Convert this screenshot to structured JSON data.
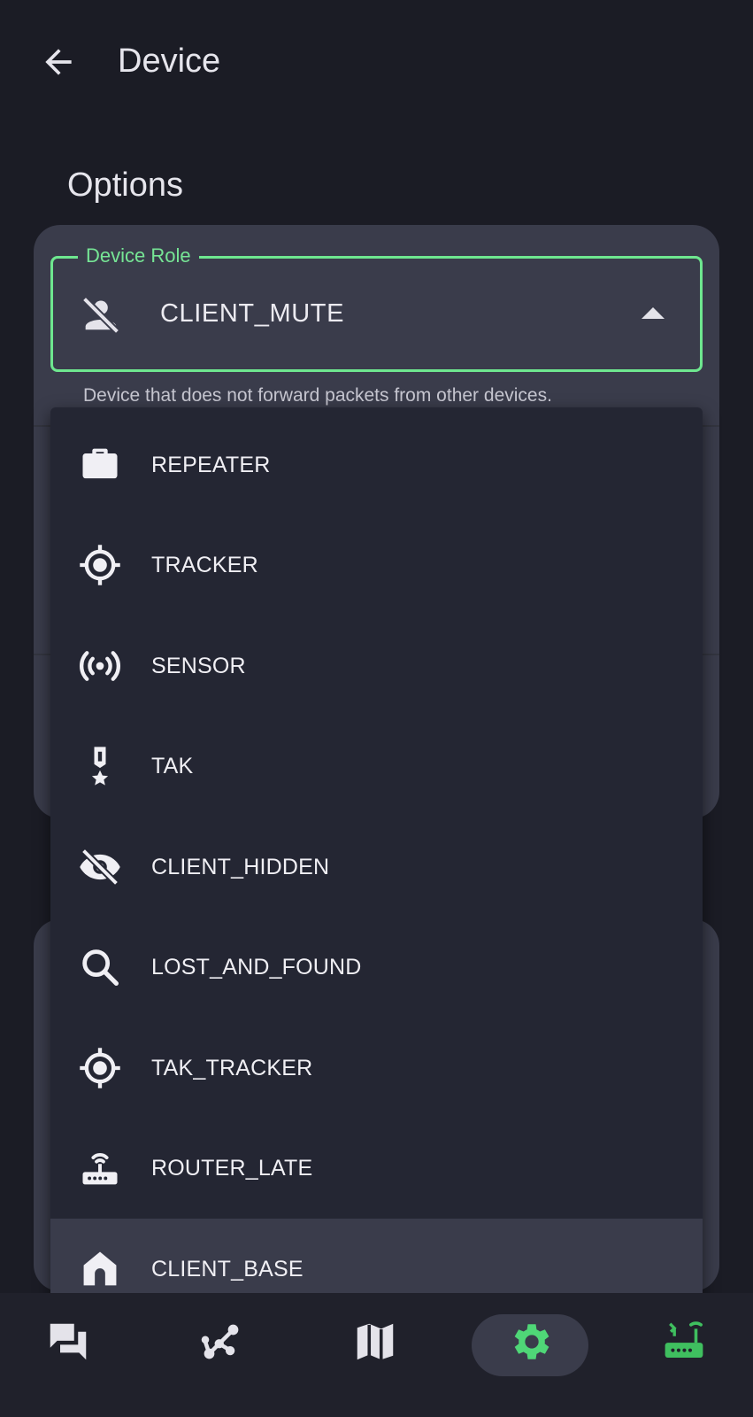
{
  "header": {
    "title": "Device",
    "back_icon": "arrow-left-icon"
  },
  "options": {
    "section_title": "Options"
  },
  "device_role": {
    "label": "Device Role",
    "value": "CLIENT_MUTE",
    "icon": "person-off-icon",
    "helper": "Device that does not forward packets from other devices.",
    "expanded": true
  },
  "menu": {
    "items": [
      {
        "label": "REPEATER",
        "icon": "briefcase-icon",
        "selected": false
      },
      {
        "label": "TRACKER",
        "icon": "gps-fixed-icon",
        "selected": false
      },
      {
        "label": "SENSOR",
        "icon": "sensors-icon",
        "selected": false
      },
      {
        "label": "TAK",
        "icon": "military-medal-icon",
        "selected": false
      },
      {
        "label": "CLIENT_HIDDEN",
        "icon": "eye-off-icon",
        "selected": false
      },
      {
        "label": "LOST_AND_FOUND",
        "icon": "search-icon",
        "selected": false
      },
      {
        "label": "TAK_TRACKER",
        "icon": "gps-fixed-icon",
        "selected": false
      },
      {
        "label": "ROUTER_LATE",
        "icon": "router-icon",
        "selected": false
      },
      {
        "label": "CLIENT_BASE",
        "icon": "home-icon",
        "selected": true
      }
    ]
  },
  "bottom_nav": {
    "items": [
      {
        "icon": "messages-icon",
        "active": false
      },
      {
        "icon": "nodes-icon",
        "active": false
      },
      {
        "icon": "map-icon",
        "active": false
      },
      {
        "icon": "settings-icon",
        "active": true
      },
      {
        "icon": "router-status-icon",
        "active": false
      }
    ]
  },
  "colors": {
    "background": "#1b1c25",
    "card": "#3a3c4b",
    "menu": "#242633",
    "accent_green": "#6ee78f",
    "status_green": "#3fbf5f",
    "text": "#e4e3ea"
  }
}
